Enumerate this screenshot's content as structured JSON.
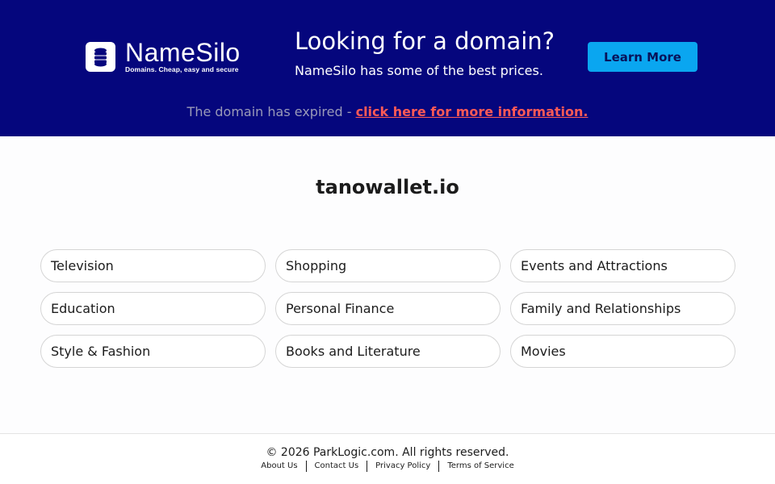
{
  "brand": {
    "name": "NameSilo",
    "tagline": "Domains. Cheap, easy and secure",
    "logo_icon": "database-stack-icon"
  },
  "promo": {
    "title": "Looking for a domain?",
    "subtitle": "NameSilo has some of the best prices.",
    "button_label": "Learn More"
  },
  "notice": {
    "text": "The domain has expired - ",
    "link_label": "click here for more information."
  },
  "domain": "tanowallet.io",
  "categories": [
    "Television",
    "Shopping",
    "Events and Attractions",
    "Education",
    "Personal Finance",
    "Family and Relationships",
    "Style & Fashion",
    "Books and Literature",
    "Movies"
  ],
  "footer": {
    "copyright": "© 2026 ParkLogic.com. All rights reserved.",
    "links": [
      "About Us",
      "Contact Us",
      "Privacy Policy",
      "Terms of Service"
    ]
  },
  "colors": {
    "banner_bg": "#05067d",
    "button_bg": "#0aa6f0",
    "link_accent": "#ff5a56"
  }
}
